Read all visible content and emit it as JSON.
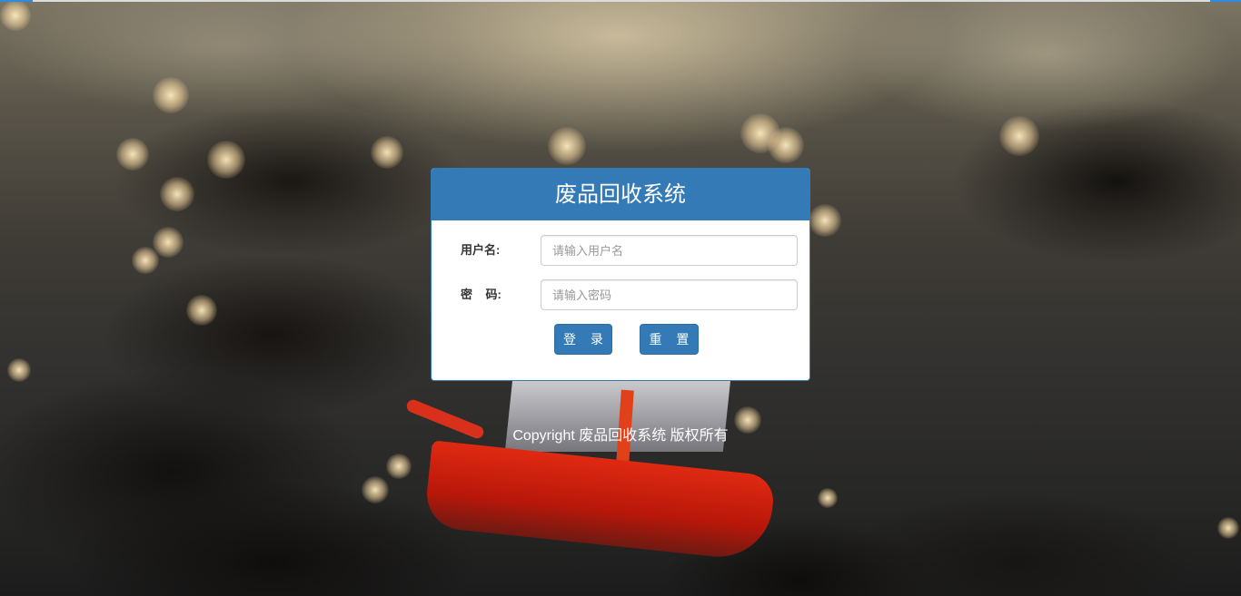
{
  "app": {
    "title": "废品回收系统"
  },
  "form": {
    "username_label": "用户名:",
    "username_placeholder": "请输入用户名",
    "username_value": "",
    "password_label": "密    码:",
    "password_placeholder": "请输入密码",
    "password_value": "",
    "login_label": "登 录",
    "reset_label": "重 置"
  },
  "footer": {
    "copyright": "Copyright 废品回收系统 版权所有"
  },
  "colors": {
    "primary": "#337ab7",
    "topbar_accent": "#2e8be0"
  }
}
